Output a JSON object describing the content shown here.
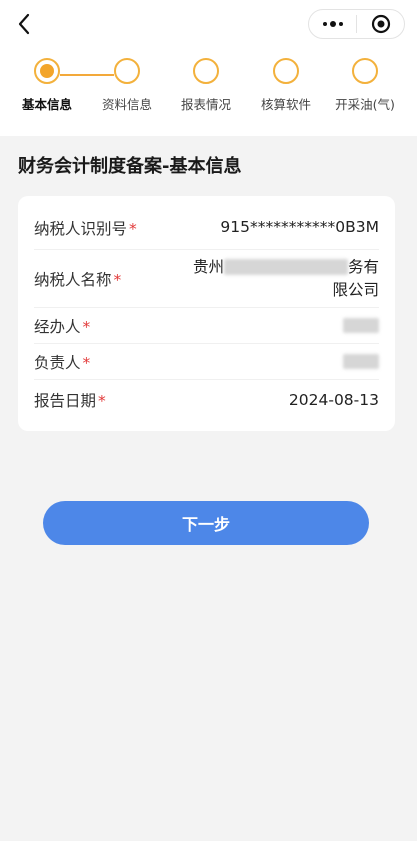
{
  "nav": {
    "back_icon": "chevron-left-icon",
    "more_icon": "more-dots-icon",
    "close_icon": "target-close-icon"
  },
  "steps": [
    {
      "label": "基本信息",
      "state": "active"
    },
    {
      "label": "资料信息",
      "state": "pending"
    },
    {
      "label": "报表情况",
      "state": "pending"
    },
    {
      "label": "核算软件",
      "state": "pending"
    },
    {
      "label": "开采油(气)",
      "state": "pending"
    }
  ],
  "colors": {
    "accent": "#f3a52a",
    "primary_button": "#4d87e8",
    "required": "#e23a3a",
    "background": "#f3f3f3"
  },
  "section_title": "财务会计制度备案-基本信息",
  "form": {
    "taxpayer_id": {
      "label": "纳税人识别号",
      "required": "*",
      "value": "915***********0B3M"
    },
    "taxpayer_name": {
      "label": "纳税人名称",
      "required": "*",
      "value_prefix": "贵州",
      "value_suffix": "务有",
      "value_line2": "限公司"
    },
    "operator": {
      "label": "经办人",
      "required": "*"
    },
    "responsible": {
      "label": "负责人",
      "required": "*"
    },
    "report_date": {
      "label": "报告日期",
      "required": "*",
      "value": "2024-08-13"
    }
  },
  "next_button": "下一步"
}
